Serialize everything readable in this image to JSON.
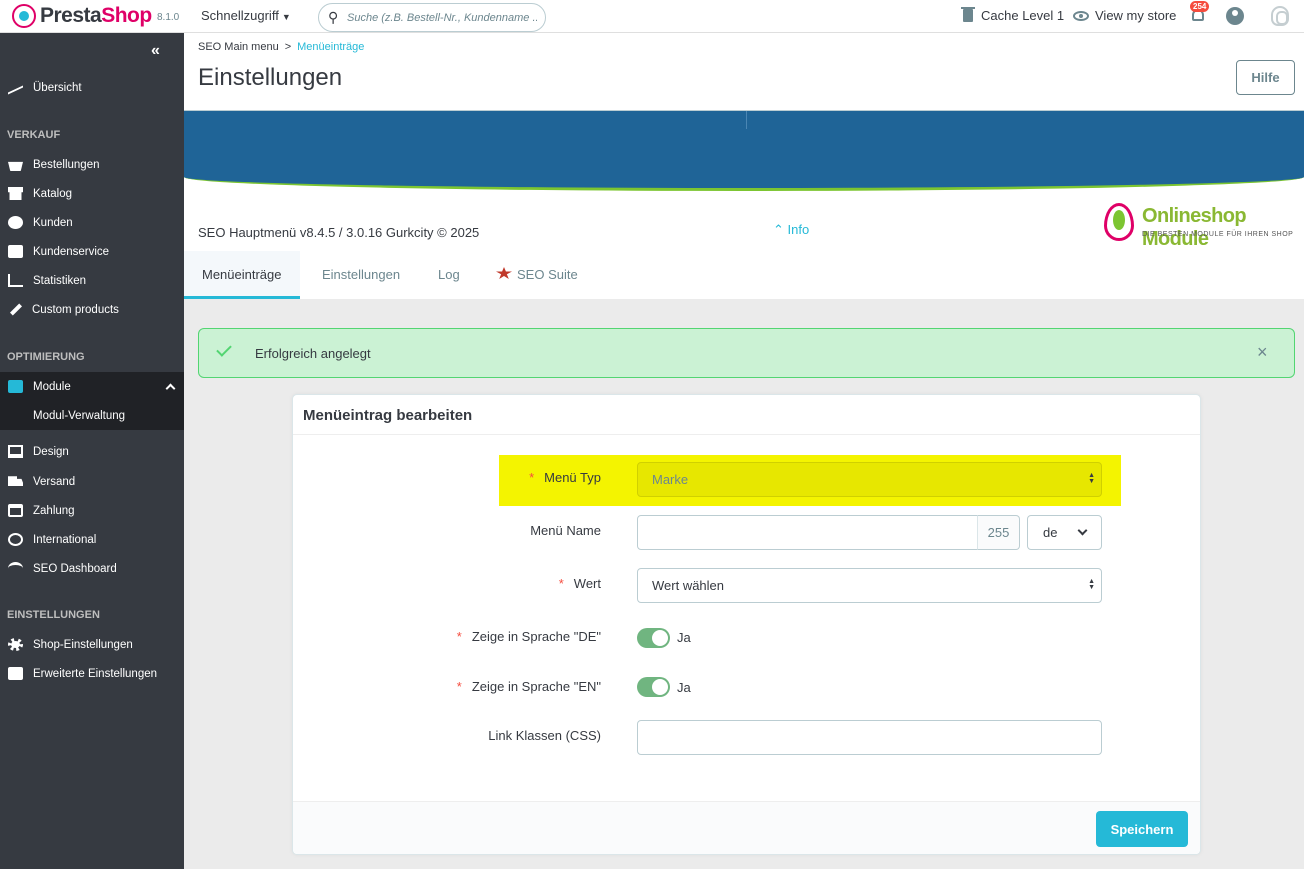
{
  "topbar": {
    "brand_part1": "Presta",
    "brand_part2": "Shop",
    "version": "8.1.0",
    "quick_access": "Schnellzugriff",
    "search_placeholder": "Suche (z.B. Bestell-Nr., Kundenname ...",
    "cache_level": "Cache Level 1",
    "view_store": "View my store",
    "notification_count": "254"
  },
  "sidebar": {
    "items_top": [
      {
        "label": "Übersicht",
        "icon": "trend-icon"
      }
    ],
    "sections": [
      {
        "title": "VERKAUF",
        "items": [
          "Bestellungen",
          "Katalog",
          "Kunden",
          "Kundenservice",
          "Statistiken",
          "Custom products"
        ]
      },
      {
        "title": "OPTIMIERUNG",
        "items": [
          "Module",
          "Design",
          "Versand",
          "Zahlung",
          "International",
          "SEO Dashboard"
        ],
        "sub": "Modul-Verwaltung"
      },
      {
        "title": "EINSTELLUNGEN",
        "items": [
          "Shop-Einstellungen",
          "Erweiterte Einstellungen"
        ]
      }
    ]
  },
  "header": {
    "breadcrumb_root": "SEO Main menu",
    "breadcrumb_sep": ">",
    "breadcrumb_current": "Menüeinträge",
    "title": "Einstellungen",
    "help_label": "Hilfe"
  },
  "banner": {
    "version_text": "SEO Hauptmenü v8.4.5 / 3.0.16 Gurkcity © 2025",
    "info_label": "Info",
    "logo_title": "Onlineshop Module",
    "logo_tagline": "DIE BESTEN MODULE FÜR IHREN SHOP"
  },
  "tabs": [
    {
      "label": "Menüeinträge",
      "active": true
    },
    {
      "label": "Einstellungen",
      "active": false
    },
    {
      "label": "Log",
      "active": false
    },
    {
      "label": "SEO Suite",
      "active": false
    }
  ],
  "alert": {
    "message": "Erfolgreich angelegt",
    "close": "×"
  },
  "form": {
    "title": "Menüeintrag bearbeiten",
    "menu_type_label": "Menü Typ",
    "menu_type_value": "Marke",
    "menu_name_label": "Menü Name",
    "menu_name_value": "",
    "menu_name_counter": "255",
    "menu_name_lang": "de",
    "wert_label": "Wert",
    "wert_value": "Wert wählen",
    "show_de_label": "Zeige in Sprache \"DE\"",
    "show_de_value": "Ja",
    "show_en_label": "Zeige in Sprache \"EN\"",
    "show_en_value": "Ja",
    "link_css_label": "Link Klassen (CSS)",
    "link_css_value": "",
    "required_mark": "*",
    "save_label": "Speichern"
  },
  "colors": {
    "accent": "#25b9d7",
    "sidebar": "#363a41",
    "highlight": "#f4f400",
    "success": "#53d572"
  }
}
